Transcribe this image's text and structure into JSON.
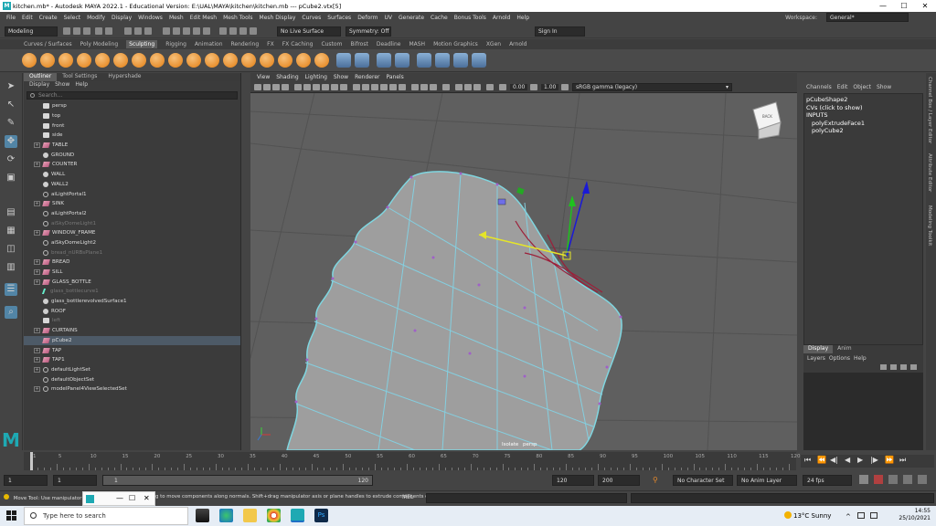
{
  "window": {
    "title": "kitchen.mb* - Autodesk MAYA 2022.1 - Educational Version: E:\\UAL\\MAYA\\kitchen\\kitchen.mb  ---  pCube2.vtx[5]",
    "minimize": "—",
    "maximize": "☐",
    "close": "✕"
  },
  "menubar": {
    "items": [
      "File",
      "Edit",
      "Create",
      "Select",
      "Modify",
      "Display",
      "Windows",
      "Mesh",
      "Edit Mesh",
      "Mesh Tools",
      "Mesh Display",
      "Curves",
      "Surfaces",
      "Deform",
      "UV",
      "Generate",
      "Cache",
      "Bonus Tools",
      "Arnold",
      "Help"
    ],
    "workspace_label": "Workspace:",
    "workspace_value": "General*"
  },
  "statusline": {
    "mode": "Modeling",
    "live_surface": "No Live Surface",
    "symmetry": "Symmetry: Off",
    "sign_in": "Sign In"
  },
  "shelf": {
    "tabs": [
      "Curves / Surfaces",
      "Poly Modeling",
      "Sculpting",
      "Rigging",
      "Animation",
      "Rendering",
      "FX",
      "FX Caching",
      "Custom",
      "Bifrost",
      "Deadline",
      "MASH",
      "Motion Graphics",
      "XGen",
      "Arnold"
    ],
    "active_tab": "Sculpting"
  },
  "outliner": {
    "tabs": [
      "Outliner",
      "Tool Settings",
      "Hypershade"
    ],
    "menu": [
      "Display",
      "Show",
      "Help"
    ],
    "search_placeholder": "Search...",
    "items": [
      {
        "label": "persp",
        "icon": "cam",
        "expand": false,
        "dim": false,
        "selected": false
      },
      {
        "label": "top",
        "icon": "cam",
        "expand": false,
        "dim": false,
        "selected": false
      },
      {
        "label": "front",
        "icon": "cam",
        "expand": false,
        "dim": false,
        "selected": false
      },
      {
        "label": "side",
        "icon": "cam",
        "expand": false,
        "dim": false,
        "selected": false
      },
      {
        "label": "TABLE",
        "icon": "mesh",
        "expand": true,
        "dim": false,
        "selected": false
      },
      {
        "label": "GROUND",
        "icon": "light",
        "expand": false,
        "dim": false,
        "selected": false
      },
      {
        "label": "COUNTER",
        "icon": "mesh",
        "expand": true,
        "dim": false,
        "selected": false
      },
      {
        "label": "WALL",
        "icon": "light",
        "expand": false,
        "dim": false,
        "selected": false
      },
      {
        "label": "WALL2",
        "icon": "light",
        "expand": false,
        "dim": false,
        "selected": false
      },
      {
        "label": "aiLightPortal1",
        "icon": "set",
        "expand": false,
        "dim": false,
        "selected": false
      },
      {
        "label": "SINK",
        "icon": "mesh",
        "expand": true,
        "dim": false,
        "selected": false
      },
      {
        "label": "aiLightPortal2",
        "icon": "set",
        "expand": false,
        "dim": false,
        "selected": false
      },
      {
        "label": "aiSkyDomeLight1",
        "icon": "set",
        "expand": false,
        "dim": true,
        "selected": false
      },
      {
        "label": "WINDOW_FRAME",
        "icon": "mesh",
        "expand": true,
        "dim": false,
        "selected": false
      },
      {
        "label": "aiSkyDomeLight2",
        "icon": "set",
        "expand": false,
        "dim": false,
        "selected": false
      },
      {
        "label": "bread_nURBsPlane1",
        "icon": "set",
        "expand": false,
        "dim": true,
        "selected": false
      },
      {
        "label": "BREAD",
        "icon": "mesh",
        "expand": true,
        "dim": false,
        "selected": false
      },
      {
        "label": "SILL",
        "icon": "mesh",
        "expand": true,
        "dim": false,
        "selected": false
      },
      {
        "label": "GLASS_BOTTLE",
        "icon": "mesh",
        "expand": true,
        "dim": false,
        "selected": false
      },
      {
        "label": "glass_bottlecurve1",
        "icon": "curve",
        "expand": false,
        "dim": true,
        "selected": false
      },
      {
        "label": "glass_bottlerevolvedSurface1",
        "icon": "light",
        "expand": false,
        "dim": false,
        "selected": false
      },
      {
        "label": "ROOF",
        "icon": "light",
        "expand": false,
        "dim": false,
        "selected": false
      },
      {
        "label": "left",
        "icon": "cam",
        "expand": false,
        "dim": true,
        "selected": false
      },
      {
        "label": "CURTAINS",
        "icon": "mesh",
        "expand": true,
        "dim": false,
        "selected": false
      },
      {
        "label": "pCube2",
        "icon": "mesh",
        "expand": false,
        "dim": false,
        "selected": true
      },
      {
        "label": "TAP",
        "icon": "mesh",
        "expand": true,
        "dim": false,
        "selected": false
      },
      {
        "label": "TAP1",
        "icon": "mesh",
        "expand": true,
        "dim": false,
        "selected": false
      },
      {
        "label": "defaultLightSet",
        "icon": "set",
        "expand": true,
        "dim": false,
        "selected": false
      },
      {
        "label": "defaultObjectSet",
        "icon": "set",
        "expand": false,
        "dim": false,
        "selected": false
      },
      {
        "label": "modelPanel4ViewSelectedSet",
        "icon": "set",
        "expand": true,
        "dim": false,
        "selected": false
      }
    ]
  },
  "viewport": {
    "menu": [
      "View",
      "Shading",
      "Lighting",
      "Show",
      "Renderer",
      "Panels"
    ],
    "exposure": "0.00",
    "gamma": "1.00",
    "color_space": "sRGB gamma (legacy)",
    "hud_isolate": "Isolate",
    "hud_camera": "persp",
    "viewcube_label": "BACK"
  },
  "channelbox": {
    "menu": [
      "Channels",
      "Edit",
      "Object",
      "Show"
    ],
    "shape": "pCubeShape2",
    "cvs": "CVs (click to show)",
    "inputs": "INPUTS",
    "input_items": [
      "polyExtrudeFace1",
      "polyCube2"
    ],
    "side_tabs": [
      "Channel Box / Layer Editor",
      "Attribute Editor",
      "Modeling Toolkit"
    ]
  },
  "layers": {
    "tabs": [
      "Display",
      "Anim"
    ],
    "menu": [
      "Layers",
      "Options",
      "Help"
    ]
  },
  "timeslider": {
    "labels": [
      "1",
      "5",
      "10",
      "15",
      "20",
      "25",
      "30",
      "35",
      "40",
      "45",
      "50",
      "55",
      "60",
      "65",
      "70",
      "75",
      "80",
      "85",
      "90",
      "95",
      "100",
      "105",
      "110",
      "115",
      "120"
    ],
    "current_frame": "1"
  },
  "rangeslider": {
    "start": "1",
    "playback_start": "1",
    "range_start": "1",
    "range_end": "120",
    "playback_end": "120",
    "end": "200",
    "character_set": "No Character Set",
    "anim_layer": "No Anim Layer",
    "fps": "24 fps"
  },
  "cmdline": {
    "help": "Move Tool: Use manipulator",
    "help_tail": "g to move components along normals. Shift+drag manipulator axis or plane handles to extrude components or c",
    "lang": "MEL"
  },
  "taskbar": {
    "search_placeholder": "Type here to search",
    "weather": "13°C  Sunny",
    "time": "14:55",
    "date": "25/10/2021"
  }
}
